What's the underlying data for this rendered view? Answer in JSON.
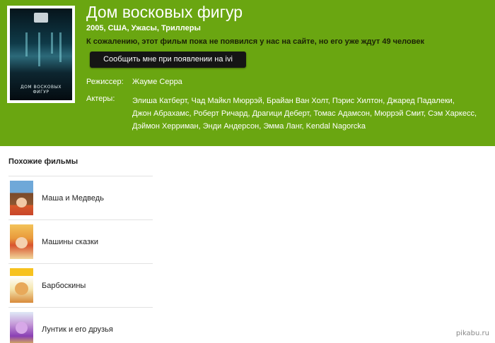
{
  "movie": {
    "title": "Дом восковых фигур",
    "meta": "2005, США, Ужасы, Триллеры",
    "availability_note": "К сожалению, этот фильм пока не появился у нас на сайте, но его уже ждут 49 человек",
    "notify_button_label": "Сообщить мне при появлении на ivi",
    "poster_title": "ДОМ ВОСКОВЫХ ФИГУР",
    "director_label": "Режиссер:",
    "director": "Жауме Серра",
    "actors_label": "Актеры:",
    "actors": [
      "Элиша Катберт,",
      "Чад Майкл Мюррэй,",
      "Брайан Ван Холт,",
      "Пэрис Хилтон,",
      "Джаред Падалеки,",
      "Джон Абрахамс,",
      "Роберт Ричард,",
      "Драгици Деберт,",
      "Томас Адамсон,",
      "Мюррэй Смит,",
      "Сэм Харкесс,",
      "Дэймон Херриман,",
      "Энди Андерсон,",
      "Эмма Ланг,",
      "Kendal Nagorcka"
    ]
  },
  "similar": {
    "heading": "Похожие фильмы",
    "items": [
      {
        "label": "Маша и Медведь"
      },
      {
        "label": "Машины сказки"
      },
      {
        "label": "Барбоскины"
      },
      {
        "label": "Лунтик и его друзья"
      }
    ]
  },
  "watermark": "pikabu.ru",
  "colors": {
    "hero_bg": "#6aa611",
    "button_bg": "#151515"
  }
}
